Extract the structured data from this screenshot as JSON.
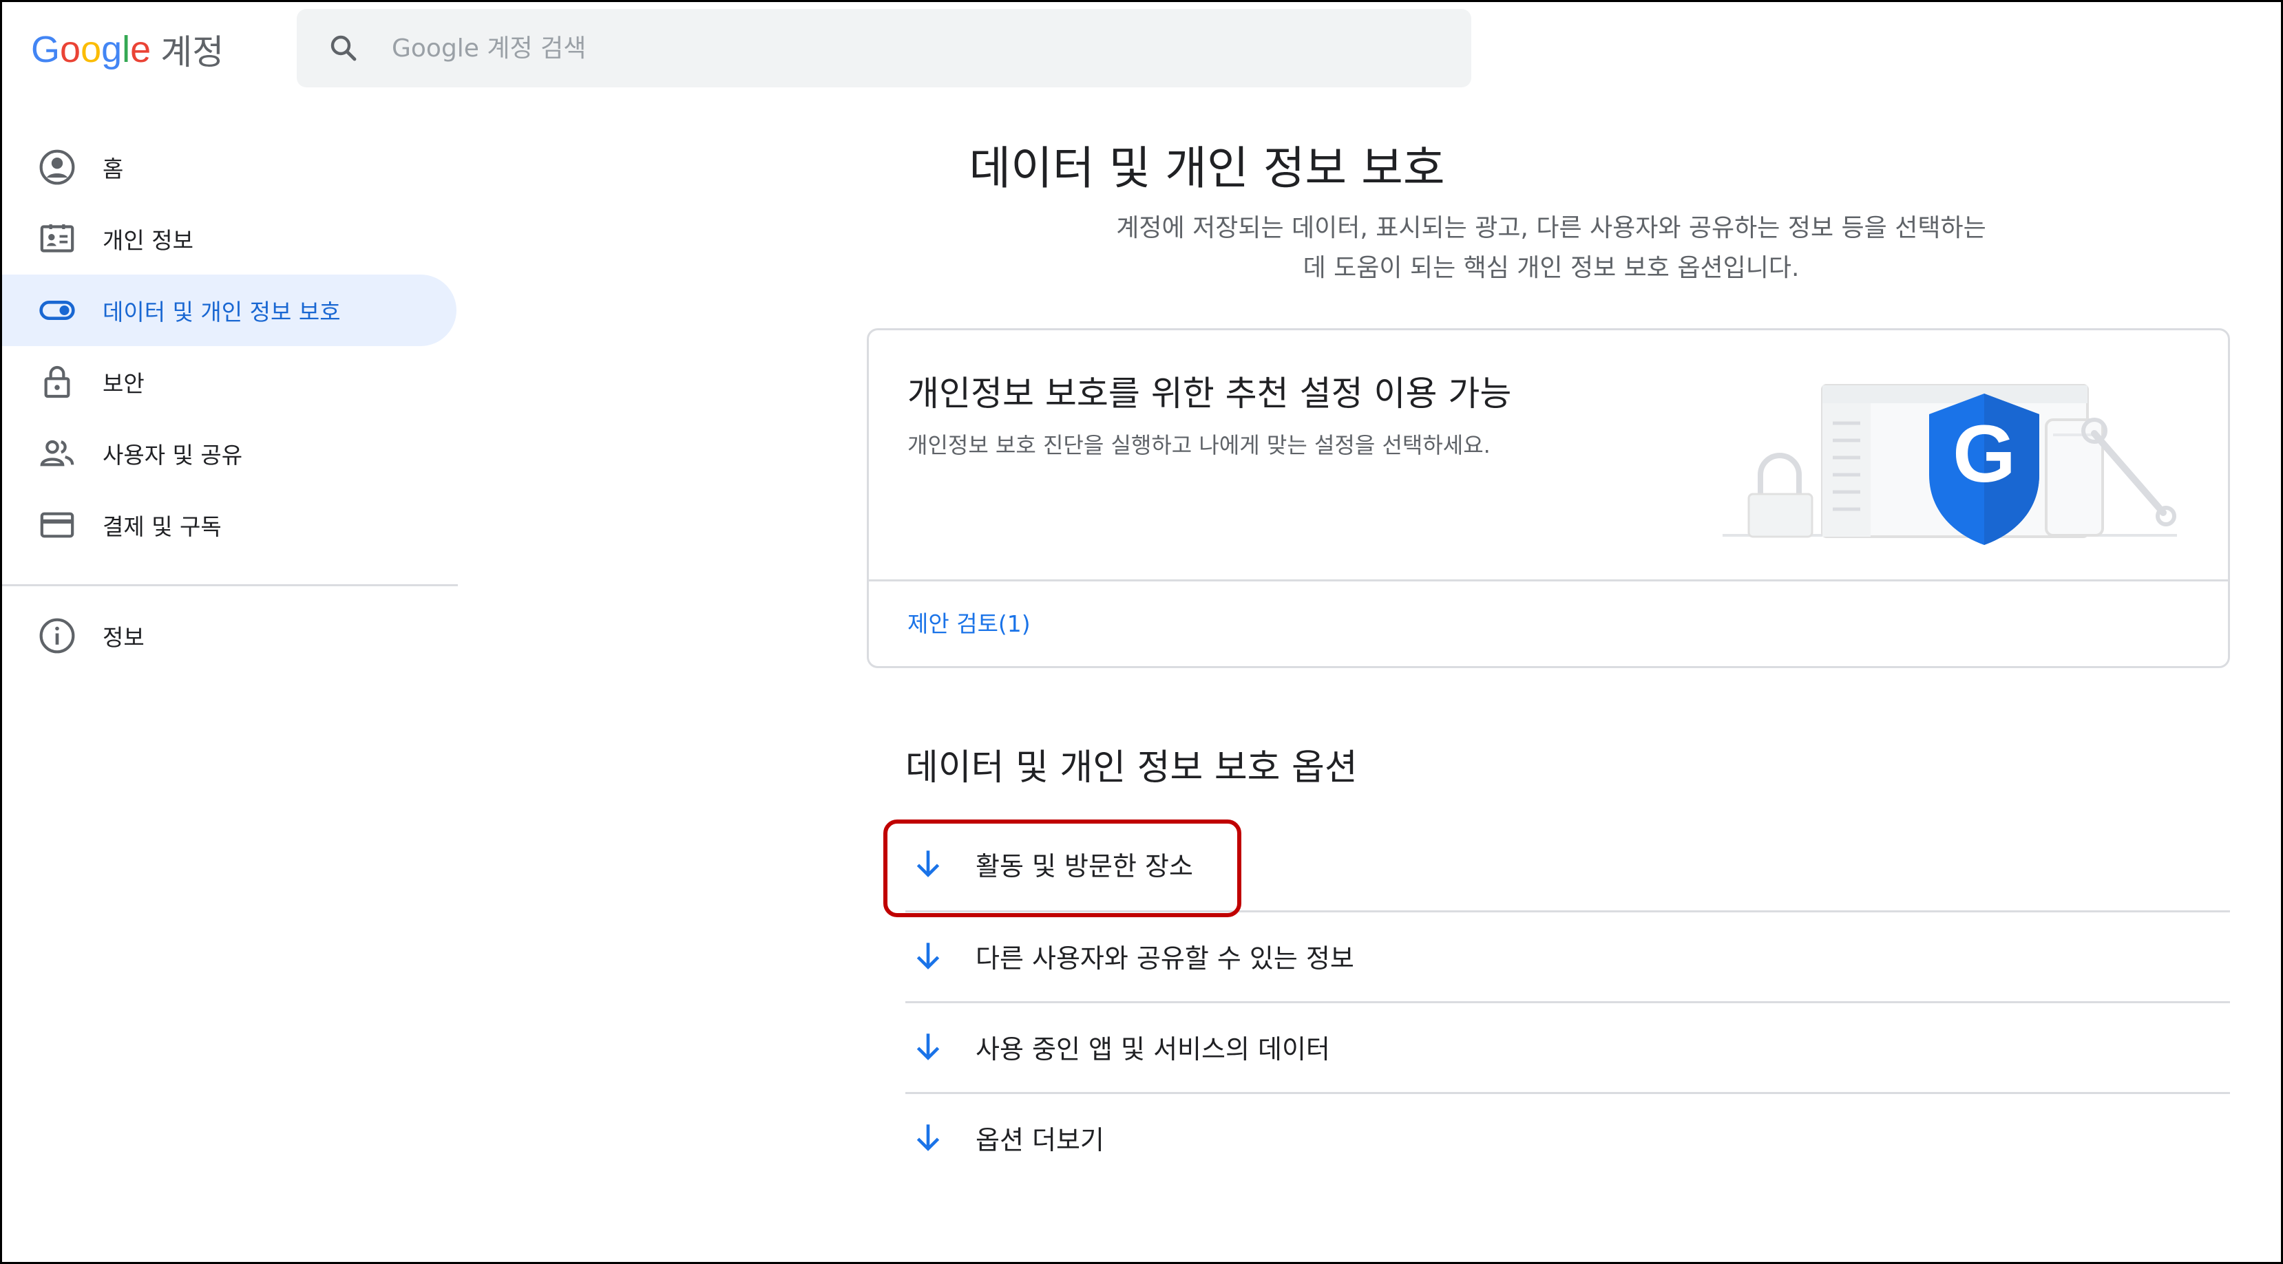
{
  "header": {
    "logo_word": "Google",
    "product": "계정",
    "search_placeholder": "Google 계정 검색"
  },
  "colors": {
    "accent": "#1a73e8",
    "active_bg": "#e8f0fe",
    "highlight_border": "#c00000",
    "logo_blue": "#4285F4",
    "logo_red": "#EA4335",
    "logo_yellow": "#FBBC05",
    "logo_green": "#34A853"
  },
  "sidebar": {
    "items": [
      {
        "label": "홈",
        "icon": "account-circle-icon"
      },
      {
        "label": "개인 정보",
        "icon": "id-card-icon"
      },
      {
        "label": "데이터 및 개인 정보 보호",
        "icon": "toggle-icon",
        "active": true
      },
      {
        "label": "보안",
        "icon": "lock-icon"
      },
      {
        "label": "사용자 및 공유",
        "icon": "people-icon"
      },
      {
        "label": "결제 및 구독",
        "icon": "credit-card-icon"
      }
    ],
    "footer_items": [
      {
        "label": "정보",
        "icon": "info-icon"
      }
    ]
  },
  "main": {
    "title": "데이터 및 개인 정보 보호",
    "description_line1": "계정에 저장되는 데이터, 표시되는 광고, 다른 사용자와 공유하는 정보 등을 선택하는",
    "description_line2": "데 도움이 되는 핵심 개인 정보 보호 옵션입니다.",
    "card": {
      "title": "개인정보 보호를 위한 추천 설정 이용 가능",
      "subtitle": "개인정보 보호 진단을 실행하고 나에게 맞는 설정을 선택하세요.",
      "link": "제안 검토(1)"
    },
    "options_title": "데이터 및 개인 정보 보호 옵션",
    "options": [
      {
        "label": "활동 및 방문한 장소",
        "icon": "arrow-down-icon",
        "highlighted": true
      },
      {
        "label": "다른 사용자와 공유할 수 있는 정보",
        "icon": "arrow-down-icon"
      },
      {
        "label": "사용 중인 앱 및 서비스의 데이터",
        "icon": "arrow-down-icon"
      },
      {
        "label": "옵션 더보기",
        "icon": "arrow-down-icon"
      }
    ]
  }
}
